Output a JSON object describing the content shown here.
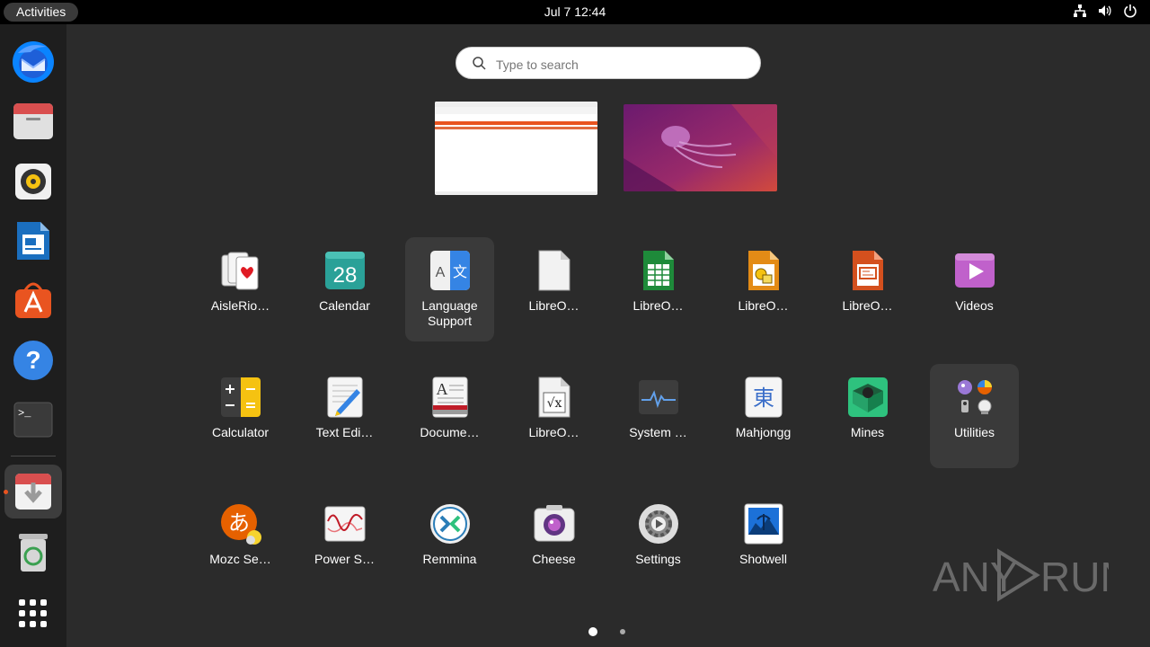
{
  "topbar": {
    "activities": "Activities",
    "clock": "Jul 7  12:44",
    "tray_icons": [
      "network-icon",
      "volume-icon",
      "power-icon"
    ]
  },
  "dock": {
    "items": [
      {
        "name": "Thunderbird",
        "icon": "thunderbird-icon"
      },
      {
        "name": "Files",
        "icon": "files-icon"
      },
      {
        "name": "Rhythmbox",
        "icon": "rhythmbox-icon"
      },
      {
        "name": "LibreOffice Writer",
        "icon": "writer-icon"
      },
      {
        "name": "Ubuntu Software",
        "icon": "software-icon"
      },
      {
        "name": "Help",
        "icon": "help-icon"
      },
      {
        "name": "Terminal",
        "icon": "terminal-icon"
      },
      {
        "name": "Software Updater",
        "icon": "updater-icon",
        "running": true
      },
      {
        "name": "Trash",
        "icon": "trash-icon"
      },
      {
        "name": "Show Applications",
        "icon": "grid-icon"
      }
    ]
  },
  "search": {
    "placeholder": "Type to search",
    "value": ""
  },
  "apps": [
    {
      "label": "AisleRio…",
      "icon": "cards-icon"
    },
    {
      "label": "Calendar",
      "icon": "calendar-icon",
      "icon_text": "28"
    },
    {
      "label": "Language\nSupport",
      "icon": "language-icon",
      "icon_text_a": "A",
      "icon_text_b": "文",
      "highlighted": true
    },
    {
      "label": "LibreO…",
      "icon": "libreoffice-icon"
    },
    {
      "label": "LibreO…",
      "icon": "calc-icon"
    },
    {
      "label": "LibreO…",
      "icon": "draw-icon"
    },
    {
      "label": "LibreO…",
      "icon": "impress-icon"
    },
    {
      "label": "Videos",
      "icon": "videos-icon"
    },
    {
      "label": "Calculator",
      "icon": "calculator-icon"
    },
    {
      "label": "Text Edi…",
      "icon": "text-editor-icon"
    },
    {
      "label": "Docume…",
      "icon": "document-viewer-icon",
      "icon_text": "A"
    },
    {
      "label": "LibreO…",
      "icon": "math-icon",
      "icon_text": "√x"
    },
    {
      "label": "System …",
      "icon": "system-monitor-icon"
    },
    {
      "label": "Mahjongg",
      "icon": "mahjongg-icon",
      "icon_text": "東"
    },
    {
      "label": "Mines",
      "icon": "mines-icon"
    },
    {
      "label": "Utilities",
      "icon": "utilities-folder-icon",
      "highlighted": true
    },
    {
      "label": "Mozc Se…",
      "icon": "mozc-icon",
      "icon_text": "あ"
    },
    {
      "label": "Power S…",
      "icon": "power-statistics-icon"
    },
    {
      "label": "Remmina",
      "icon": "remmina-icon"
    },
    {
      "label": "Cheese",
      "icon": "cheese-icon"
    },
    {
      "label": "Settings",
      "icon": "settings-icon"
    },
    {
      "label": "Shotwell",
      "icon": "shotwell-icon"
    }
  ],
  "pager": {
    "pages": 2,
    "current": 1
  },
  "watermark": {
    "text": "ANY RUN"
  }
}
